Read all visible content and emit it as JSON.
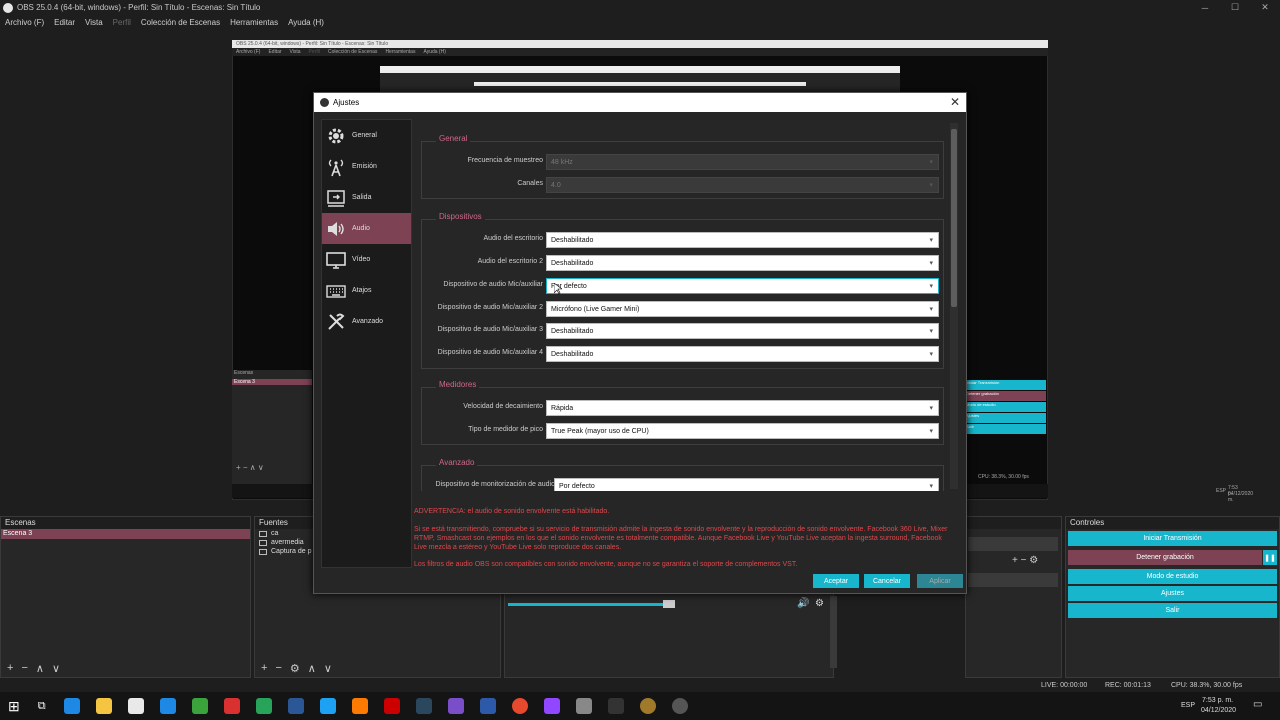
{
  "window": {
    "title": "OBS 25.0.4 (64-bit, windows) - Perfil: Sin Título - Escenas: Sin Título"
  },
  "menu": [
    "Archivo (F)",
    "Editar",
    "Vista",
    "Perfil",
    "Colección de Escenas",
    "Herramientas",
    "Ayuda (H)"
  ],
  "nested": {
    "title": "OBS 25.0.4 (64-bit, windows) - Perfil: Sin Título - Escenas: Sin Título",
    "menu": [
      "Archivo (F)",
      "Editar",
      "Vista",
      "Perfil",
      "Colección de Escenas",
      "Herramientas",
      "Ayuda (H)"
    ],
    "scenes_header": "Escenas",
    "scene": "Escena 3",
    "ctl": [
      "Iniciar Transmisión",
      "Detener grabación",
      "Modo de estudio",
      "Ajustes",
      "Salir"
    ],
    "status": "CPU: 38.3%, 30.00 fps",
    "clock": "7:53 p. m.",
    "date": "04/12/2020",
    "lang": "ESP"
  },
  "dialog": {
    "title": "Ajustes",
    "sidebar": [
      {
        "label": "General",
        "icon": "gear-icon"
      },
      {
        "label": "Emisión",
        "icon": "antenna-icon"
      },
      {
        "label": "Salida",
        "icon": "output-icon"
      },
      {
        "label": "Audio",
        "icon": "speaker-icon"
      },
      {
        "label": "Vídeo",
        "icon": "monitor-icon"
      },
      {
        "label": "Atajos",
        "icon": "keyboard-icon"
      },
      {
        "label": "Avanzado",
        "icon": "tools-icon"
      }
    ],
    "general": {
      "title": "General",
      "rows": [
        {
          "label": "Frecuencia de muestreo",
          "value": "48 kHz"
        },
        {
          "label": "Canales",
          "value": "4.0"
        }
      ]
    },
    "devices": {
      "title": "Dispositivos",
      "rows": [
        {
          "label": "Audio del escritorio",
          "value": "Deshabilitado"
        },
        {
          "label": "Audio del escritorio 2",
          "value": "Deshabilitado"
        },
        {
          "label": "Dispositivo de audio Mic/auxiliar",
          "value": "Por defecto"
        },
        {
          "label": "Dispositivo de audio Mic/auxiliar 2",
          "value": "Micrófono (Live Gamer Mini)"
        },
        {
          "label": "Dispositivo de audio Mic/auxiliar 3",
          "value": "Deshabilitado"
        },
        {
          "label": "Dispositivo de audio Mic/auxiliar 4",
          "value": "Deshabilitado"
        }
      ]
    },
    "meters": {
      "title": "Medidores",
      "rows": [
        {
          "label": "Velocidad de decaimiento",
          "value": "Rápida"
        },
        {
          "label": "Tipo de medidor de pico",
          "value": "True Peak (mayor uso de CPU)"
        }
      ]
    },
    "advanced": {
      "title": "Avanzado",
      "rows": [
        {
          "label": "Dispositivo de monitorización de audio",
          "value": "Por defecto"
        }
      ]
    },
    "warnings": [
      "ADVERTENCIA: el audio de sonido envolvente está habilitado.",
      "Si se está transmitiendo, compruebe si su servicio de transmisión admite la ingesta de sonido envolvente y la reproducción de sonido envolvente. Facebook 360 Live, Mixer RTMP, Smashcast son ejemplos en los que el sonido envolvente es totalmente compatible. Aunque Facebook Live y YouTube Live aceptan la ingesta surround, Facebook Live mezcla a estéreo y YouTube Live solo reproduce dos canales.",
      "Los filtros de audio OBS son compatibles con sonido envolvente, aunque no se garantiza el soporte de complementos VST."
    ],
    "buttons": {
      "accept": "Aceptar",
      "cancel": "Cancelar",
      "apply": "Aplicar"
    }
  },
  "docks": {
    "scenes": {
      "title": "Escenas",
      "items": [
        "Escena 3"
      ]
    },
    "sources": {
      "title": "Fuentes",
      "items": [
        "ca",
        "avermedia",
        "Captura de p"
      ]
    },
    "controls": {
      "title": "Controles",
      "buttons": [
        "Iniciar Transmisión",
        "Detener grabación",
        "Modo de estudio",
        "Ajustes",
        "Salir"
      ]
    }
  },
  "status": {
    "live": "LIVE: 00:00:00",
    "rec": "REC: 00:01:13",
    "cpu": "CPU: 38.3%, 30.00 fps"
  },
  "taskbar": {
    "lang": "ESP",
    "time": "7:53 p. m.",
    "date": "04/12/2020"
  },
  "colors": {
    "accent": "#17b6cc",
    "selected": "#7d4254",
    "group_title": "#d0668c",
    "warning": "#e0474c"
  }
}
